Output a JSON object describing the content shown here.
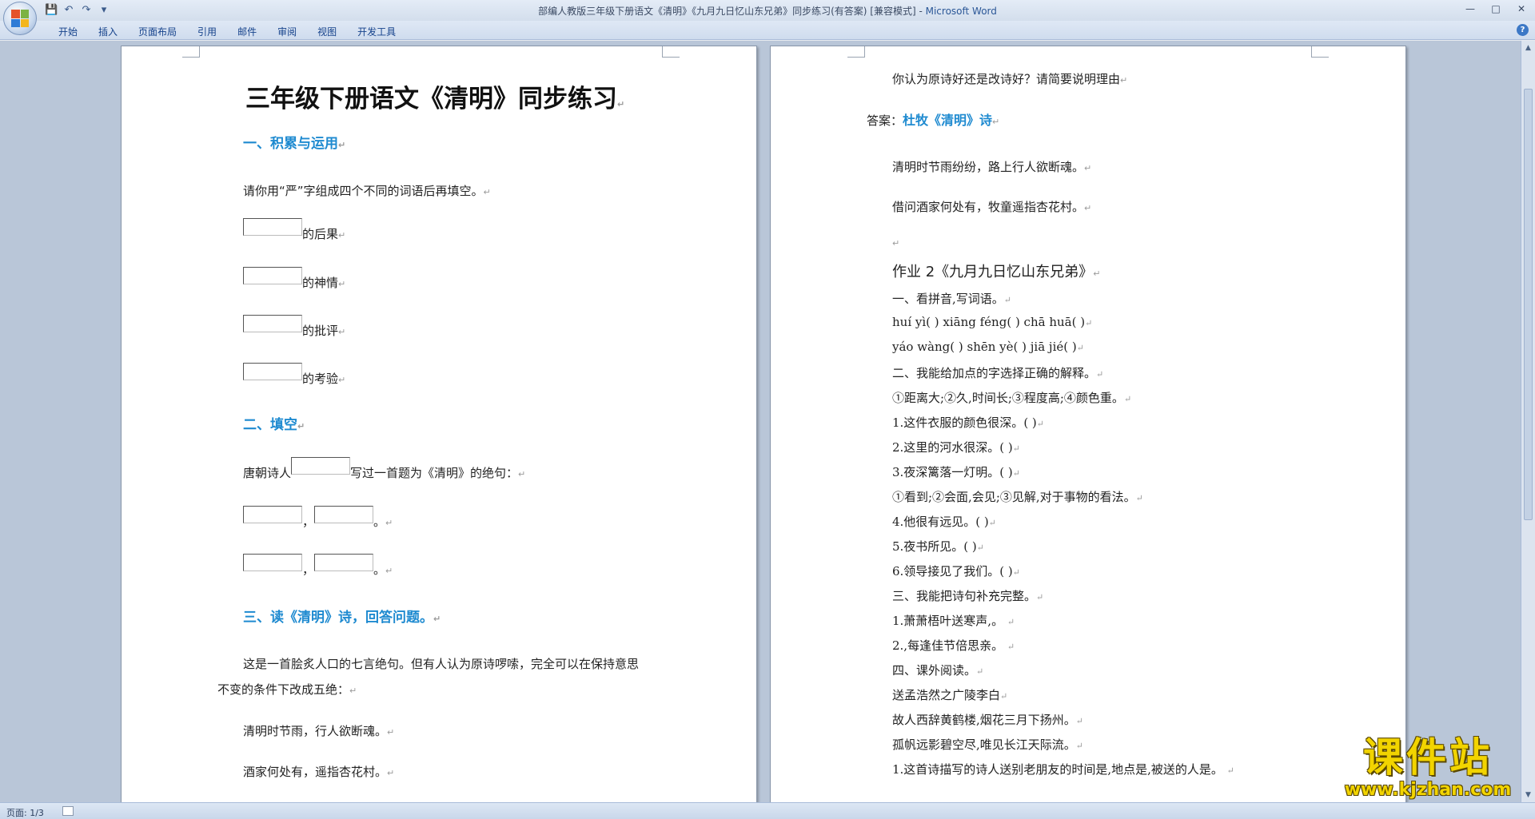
{
  "window": {
    "title": "部编人教版三年级下册语文《清明》《九月九日忆山东兄弟》同步练习(有答案) [兼容模式] - ",
    "app_name": "Microsoft Word",
    "controls": [
      "—",
      "□",
      "✕"
    ]
  },
  "qat": {
    "save_icon": "💾",
    "undo_icon": "↶",
    "redo_icon": "↷",
    "more_icon": "▾"
  },
  "ribbon": {
    "tabs": [
      "开始",
      "插入",
      "页面布局",
      "引用",
      "邮件",
      "审阅",
      "视图",
      "开发工具"
    ],
    "help_icon": "?"
  },
  "page_left": {
    "title": "三年级下册语文《清明》同步练习",
    "section1": "一、积累与运用",
    "instruction1": "请你用“严”字组成四个不同的词语后再填空。",
    "fill_items": [
      "的后果",
      "的神情",
      "的批评",
      "的考验"
    ],
    "section2": "二、填空",
    "fill2_before": "唐朝诗人",
    "fill2_after": "写过一首题为《清明》的绝句：",
    "comma": "，",
    "period": "。",
    "section3": "三、读《清明》诗，回答问题。",
    "para1_line1": "这是一首脍炙人口的七言绝句。但有人认为原诗啰嗦，完全可以在保持意思",
    "para1_line2": "不变的条件下改成五绝：",
    "poem_line1": "清明时节雨，行人欲断魂。",
    "poem_line2": "酒家何处有，遥指杏花村。"
  },
  "page_right": {
    "question": "你认为原诗好还是改诗好？请简要说明理由",
    "answer_label": "答案：",
    "answer_value": "杜牧《清明》诗",
    "poem_line1": "清明时节雨纷纷，路上行人欲断魂。",
    "poem_line2": "借问酒家何处有，牧童遥指杏花村。",
    "hw2_title": "作业 2《九月九日忆山东兄弟》",
    "lines": [
      "一、看拼音,写词语。",
      "huí yì(    )       xiāng féng(    )      chā huā(    )",
      "yáo wàng(    )     shēn yè(    )          jiā jié(    )",
      "二、我能给加点的字选择正确的解释。",
      "①距离大;②久,时间长;③程度高;④颜色重。",
      "1.这件衣服的颜色很深。(    )",
      "2.这里的河水很深。(    )",
      "3.夜深篱落一灯明。(    )",
      " ①看到;②会面,会见;③见解,对于事物的看法。",
      "4.他很有远见。(    )",
      "5.夜书所见。(    )",
      "6.领导接见了我们。(    )",
      "三、我能把诗句补充完整。",
      "1.萧萧梧叶送寒声,。    ",
      "2.,每逢佳节倍思亲。    ",
      "四、课外阅读。",
      "送孟浩然之广陵李白",
      "故人西辞黄鹤楼,烟花三月下扬州。",
      "孤帆远影碧空尽,唯见长江天际流。",
      "1.这首诗描写的诗人送别老朋友的时间是,地点是,被送的人是。    "
    ]
  },
  "statusbar": {
    "page": "页面: 1/3"
  },
  "watermark": {
    "big": "课件站",
    "small": "www.kjzhan.com"
  }
}
